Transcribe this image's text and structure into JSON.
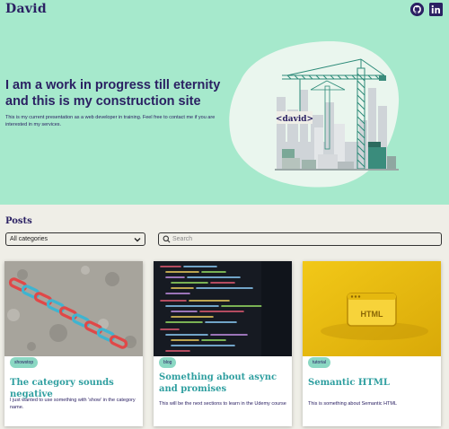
{
  "header": {
    "brand": "David"
  },
  "social": [
    {
      "icon": "github-icon"
    },
    {
      "icon": "linkedin-icon"
    }
  ],
  "hero": {
    "title": "I am a work in progress till eternity and this is my construction site",
    "text": "This is my current presentation as a web developer in training. Feel free to contact me if you are interested in my services.",
    "illustration_label": "<david>"
  },
  "posts": {
    "title": "Posts",
    "category_select": {
      "selected": "All categories"
    },
    "search": {
      "placeholder": "Search"
    },
    "items": [
      {
        "tag": "showstop",
        "title": "The category sounds negative",
        "text": "I just wanted to use something with 'show' in the category name."
      },
      {
        "tag": "blog",
        "title": "Something about async and promises",
        "text": "This will be the next sections to learn in the Udemy course"
      },
      {
        "tag": "tutorial",
        "title": "Semantic HTML",
        "text": "This is something about Semantic HTML",
        "image_label": "HTML"
      }
    ]
  },
  "colors": {
    "hero_bg": "#a6e9cc",
    "brand": "#2b2163",
    "accent": "#2f9fa0",
    "tag_bg": "#8bd8c3",
    "page_bg": "#efeee7"
  }
}
